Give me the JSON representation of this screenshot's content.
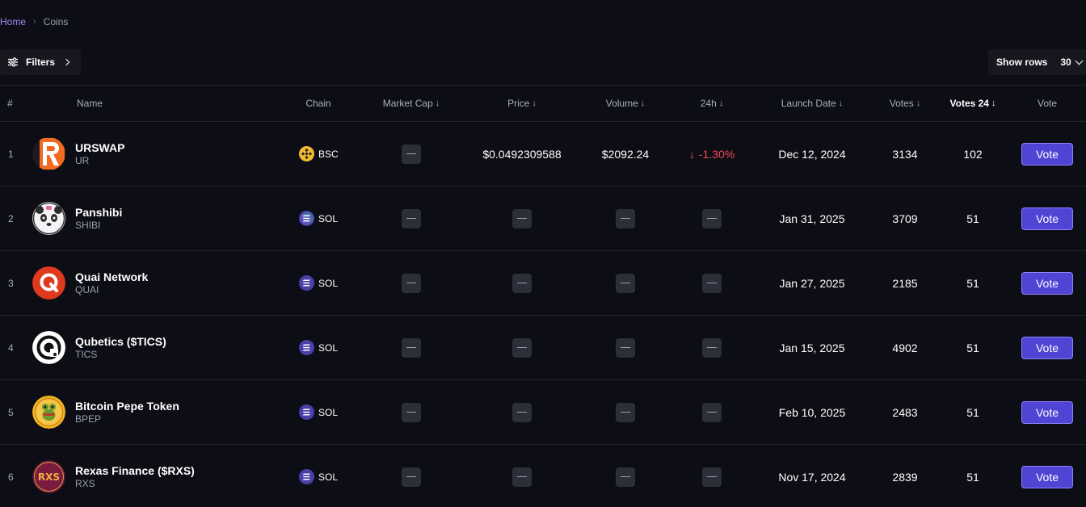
{
  "breadcrumb": {
    "home": "Home",
    "current": "Coins"
  },
  "toolbar": {
    "filters_label": "Filters",
    "show_rows_label": "Show rows",
    "show_rows_value": "30"
  },
  "columns": {
    "rank": "#",
    "name": "Name",
    "chain": "Chain",
    "market_cap": "Market Cap",
    "price": "Price",
    "volume": "Volume",
    "change24h": "24h",
    "launch_date": "Launch Date",
    "votes": "Votes",
    "votes24": "Votes 24",
    "vote": "Vote",
    "sort_arrow": "↓"
  },
  "colors": {
    "accent": "#5044d4",
    "negative": "#ef4b5c",
    "breadcrumb_link": "#9b8cf6"
  },
  "coins": [
    {
      "rank": "1",
      "name": "URSWAP",
      "symbol": "UR",
      "logo": "urswap-logo",
      "chain": "BSC",
      "market_cap": null,
      "price": "$0.0492309588",
      "volume": "$2092.24",
      "change": "-1.30%",
      "change_arrow": "↓",
      "launch_date": "Dec 12, 2024",
      "votes": "3134",
      "votes24": "102",
      "vote_label": "Vote"
    },
    {
      "rank": "2",
      "name": "Panshibi",
      "symbol": "SHIBI",
      "logo": "panda-logo",
      "chain": "SOL",
      "market_cap": null,
      "price": null,
      "volume": null,
      "change": null,
      "launch_date": "Jan 31, 2025",
      "votes": "3709",
      "votes24": "51",
      "vote_label": "Vote"
    },
    {
      "rank": "3",
      "name": "Quai Network",
      "symbol": "QUAI",
      "logo": "quai-logo",
      "chain": "SOL",
      "market_cap": null,
      "price": null,
      "volume": null,
      "change": null,
      "launch_date": "Jan 27, 2025",
      "votes": "2185",
      "votes24": "51",
      "vote_label": "Vote"
    },
    {
      "rank": "4",
      "name": "Qubetics ($TICS)",
      "symbol": "TICS",
      "logo": "qubetics-logo",
      "chain": "SOL",
      "market_cap": null,
      "price": null,
      "volume": null,
      "change": null,
      "launch_date": "Jan 15, 2025",
      "votes": "4902",
      "votes24": "51",
      "vote_label": "Vote"
    },
    {
      "rank": "5",
      "name": "Bitcoin Pepe Token",
      "symbol": "BPEP",
      "logo": "bitcoin-pepe-logo",
      "chain": "SOL",
      "market_cap": null,
      "price": null,
      "volume": null,
      "change": null,
      "launch_date": "Feb 10, 2025",
      "votes": "2483",
      "votes24": "51",
      "vote_label": "Vote"
    },
    {
      "rank": "6",
      "name": "Rexas Finance ($RXS)",
      "symbol": "RXS",
      "logo": "rexas-logo",
      "chain": "SOL",
      "market_cap": null,
      "price": null,
      "volume": null,
      "change": null,
      "launch_date": "Nov 17, 2024",
      "votes": "2839",
      "votes24": "51",
      "vote_label": "Vote"
    }
  ]
}
